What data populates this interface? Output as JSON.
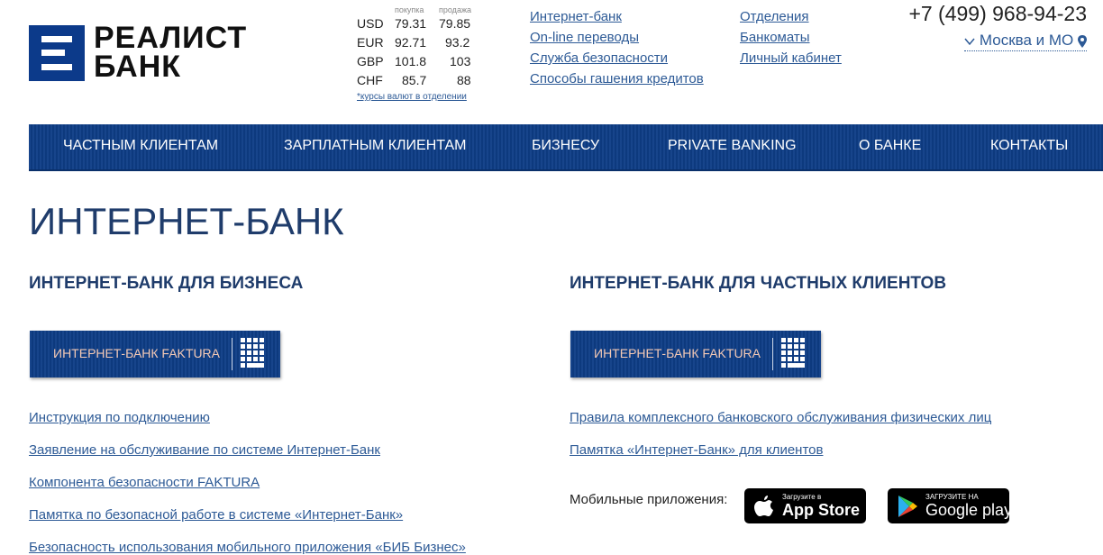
{
  "logo": {
    "line1": "РЕАЛИСТ",
    "line2": "БАНК"
  },
  "rates": {
    "buy_header": "покупка",
    "sell_header": "продажа",
    "rows": [
      {
        "code": "USD",
        "buy": "79.31",
        "sell": "79.85"
      },
      {
        "code": "EUR",
        "buy": "92.71",
        "sell": "93.2"
      },
      {
        "code": "GBP",
        "buy": "101.8",
        "sell": "103"
      },
      {
        "code": "CHF",
        "buy": "85.7",
        "sell": "88"
      }
    ],
    "note": "*курсы валют в отделении"
  },
  "top_links_col1": [
    "Интернет-банк",
    "On-line переводы",
    "Служба безопасности",
    "Способы гашения кредитов"
  ],
  "top_links_col2": [
    "Отделения",
    "Банкоматы",
    "Личный кабинет"
  ],
  "phone": "+7 (499) 968-94-23",
  "city": "Москва и МО",
  "nav": [
    "ЧАСТНЫМ КЛИЕНТАМ",
    "ЗАРПЛАТНЫМ КЛИЕНТАМ",
    "БИЗНЕСУ",
    "PRIVATE BANKING",
    "О БАНКЕ",
    "КОНТАКТЫ"
  ],
  "page_title": "ИНТЕРНЕТ-БАНК",
  "business": {
    "title": "ИНТЕРНЕТ-БАНК ДЛЯ БИЗНЕСА",
    "button": "ИНТЕРНЕТ-БАНК FAKTURA",
    "links": [
      "Инструкция по подключению",
      "Заявление на обслуживание по системе Интернет-Банк",
      "Компонента безопасности FAKTURA",
      "Памятка по безопасной работе в системе «Интернет-Банк»",
      "Безопасность использования мобильного приложения «БИБ Бизнес»"
    ]
  },
  "private": {
    "title": "ИНТЕРНЕТ-БАНК ДЛЯ ЧАСТНЫХ КЛИЕНТОВ",
    "button": "ИНТЕРНЕТ-БАНК FAKTURA",
    "links": [
      "Правила комплексного банковского обслуживания физических лиц",
      "Памятка «Интернет-Банк» для клиентов"
    ],
    "mobile_label": "Мобильные приложения:",
    "app_store": {
      "small": "Загрузите в",
      "big": "App Store"
    },
    "google_play": {
      "small": "ЗАГРУЗИТЕ НА",
      "big": "Google play"
    }
  },
  "icons": [
    "bank-logo-icon",
    "chevron-down-icon",
    "location-pin-icon",
    "keypad-icon",
    "apple-icon",
    "google-play-icon"
  ],
  "colors": {
    "brand_blue": "#0e3d86",
    "link": "#2d5a96",
    "heading": "#1f3c6b",
    "button_text": "#f4c9b5"
  }
}
